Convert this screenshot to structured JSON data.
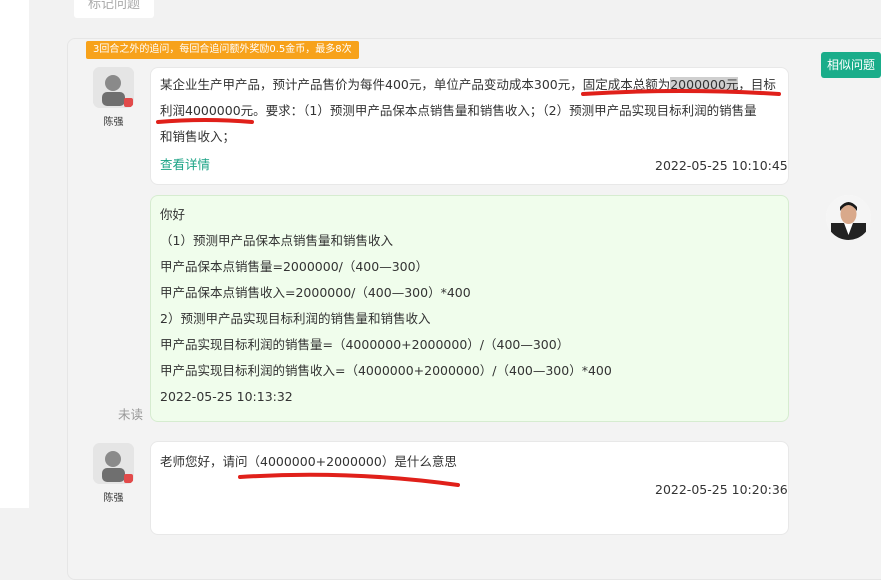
{
  "top_tab": {
    "label": "标记问题"
  },
  "notice": "3回合之外的追问，每回合追问额外奖励0.5金币，最多8次",
  "similar_button": "相似问题",
  "messages": {
    "m1": {
      "user": "陈强",
      "line1_a": "某企业生产甲产品，预计产品售价为每件400元，单位产品变动成本300元，固定成本总额为",
      "line1_hl": "2000000元",
      "line1_b": "，目标",
      "line2": "利润4000000元。要求：（1）预测甲产品保本点销售量和销售收入；（2）预测甲产品实现目标利润的销售量",
      "line3": "和销售收入；",
      "detail_link": "查看详情",
      "time": "2022-05-25 10:10:45"
    },
    "reply": {
      "lines": [
        "你好",
        "（1）预测甲产品保本点销售量和销售收入",
        "甲产品保本点销售量=2000000/（400—300）",
        "甲产品保本点销售收入=2000000/（400—300）*400",
        "2）预测甲产品实现目标利润的销售量和销售收入",
        "甲产品实现目标利润的销售量=（4000000+2000000）/（400—300）",
        "甲产品实现目标利润的销售收入=（4000000+2000000）/（400—300）*400"
      ],
      "time": "2022-05-25 10:13:32",
      "unread": "未读"
    },
    "m2": {
      "user": "陈强",
      "text": "老师您好，请问（4000000+2000000）是什么意思",
      "time": "2022-05-25 10:20:36"
    }
  },
  "colors": {
    "accent": "#1aad8a",
    "notice": "#f7a21b",
    "reply_bg": "#f0fdec",
    "annotation": "#e0201a"
  }
}
